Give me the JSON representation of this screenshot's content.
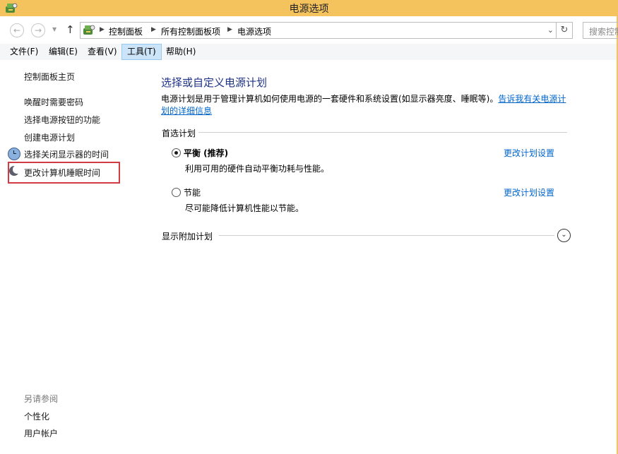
{
  "window": {
    "title": "电源选项"
  },
  "nav": {
    "back_icon": "back-arrow-icon",
    "forward_icon": "forward-arrow-icon",
    "up_icon": "up-arrow-icon",
    "breadcrumbs": [
      "控制面板",
      "所有控制面板项",
      "电源选项"
    ],
    "search_placeholder": "搜索控制"
  },
  "menu": {
    "items": [
      "文件(F)",
      "编辑(E)",
      "查看(V)",
      "工具(T)",
      "帮助(H)"
    ],
    "active_index": 3
  },
  "sidebar": {
    "home": "控制面板主页",
    "links": [
      "唤醒时需要密码",
      "选择电源按钮的功能",
      "创建电源计划",
      "选择关闭显示器的时间",
      "更改计算机睡眠时间"
    ],
    "see_also_label": "另请参阅",
    "see_also": [
      "个性化",
      "用户帐户"
    ]
  },
  "main": {
    "title": "选择或自定义电源计划",
    "description": "电源计划是用于管理计算机如何使用电源的一套硬件和系统设置(如显示器亮度、睡眠等)。",
    "help_link": "告诉我有关电源计划的详细信息",
    "preferred_label": "首选计划",
    "plans": [
      {
        "name": "平衡 (推荐)",
        "desc": "利用可用的硬件自动平衡功耗与性能。",
        "link": "更改计划设置",
        "selected": true
      },
      {
        "name": "节能",
        "desc": "尽可能降低计算机性能以节能。",
        "link": "更改计划设置",
        "selected": false
      }
    ],
    "additional_label": "显示附加计划"
  },
  "colors": {
    "titlebar": "#f4c35e",
    "link": "#0066cc",
    "title": "#1e3287",
    "highlight_box": "#d23b43"
  }
}
